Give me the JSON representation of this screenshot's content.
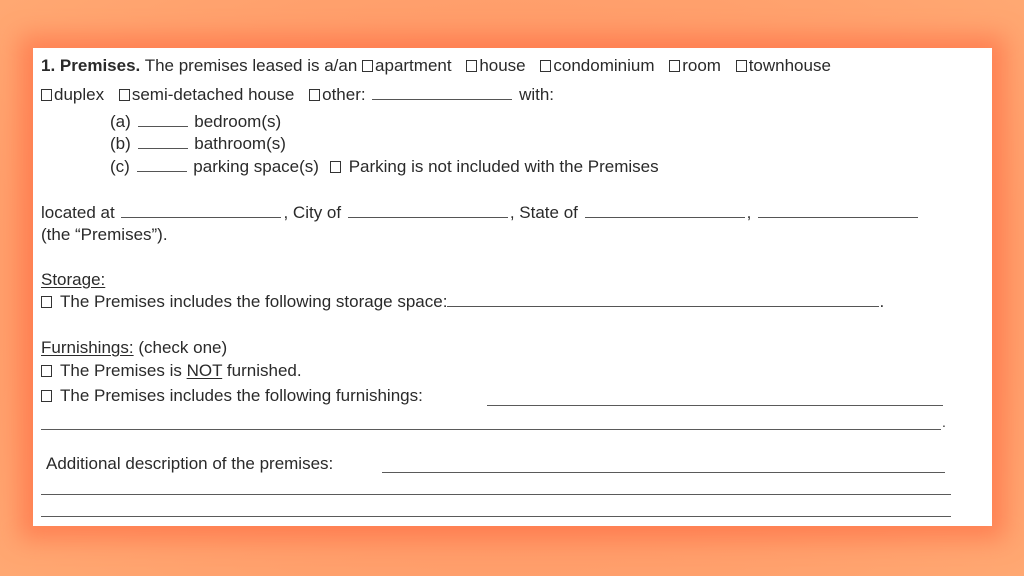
{
  "section": {
    "number": "1.",
    "title": "Premises.",
    "intro": "The premises leased is a/an",
    "type_options": [
      "apartment",
      "house",
      "condominium",
      "room",
      "townhouse",
      "duplex",
      "semi-detached house",
      "other:"
    ],
    "with_label": "with:",
    "counts": [
      {
        "marker": "(a)",
        "label": "bedroom(s)"
      },
      {
        "marker": "(b)",
        "label": "bathroom(s)"
      },
      {
        "marker": "(c)",
        "label": "parking space(s)"
      }
    ],
    "parking_not_included": "Parking is not included with the Premises"
  },
  "location": {
    "located_at": "located at",
    "city_of": ", City of",
    "state_of": ", State of",
    "comma": ",",
    "premises_def": "(the “Premises”)."
  },
  "storage": {
    "heading": "Storage:",
    "option": "The Premises includes the following storage space:",
    "end": "."
  },
  "furnishings": {
    "heading": "Furnishings:",
    "note": "(check one)",
    "not_furnished_pre": "The Premises is",
    "not_furnished_emph": "NOT",
    "not_furnished_post": "furnished.",
    "includes": "The Premises includes the following furnishings:",
    "end": "."
  },
  "additional": {
    "label": "Additional description of the premises:"
  }
}
